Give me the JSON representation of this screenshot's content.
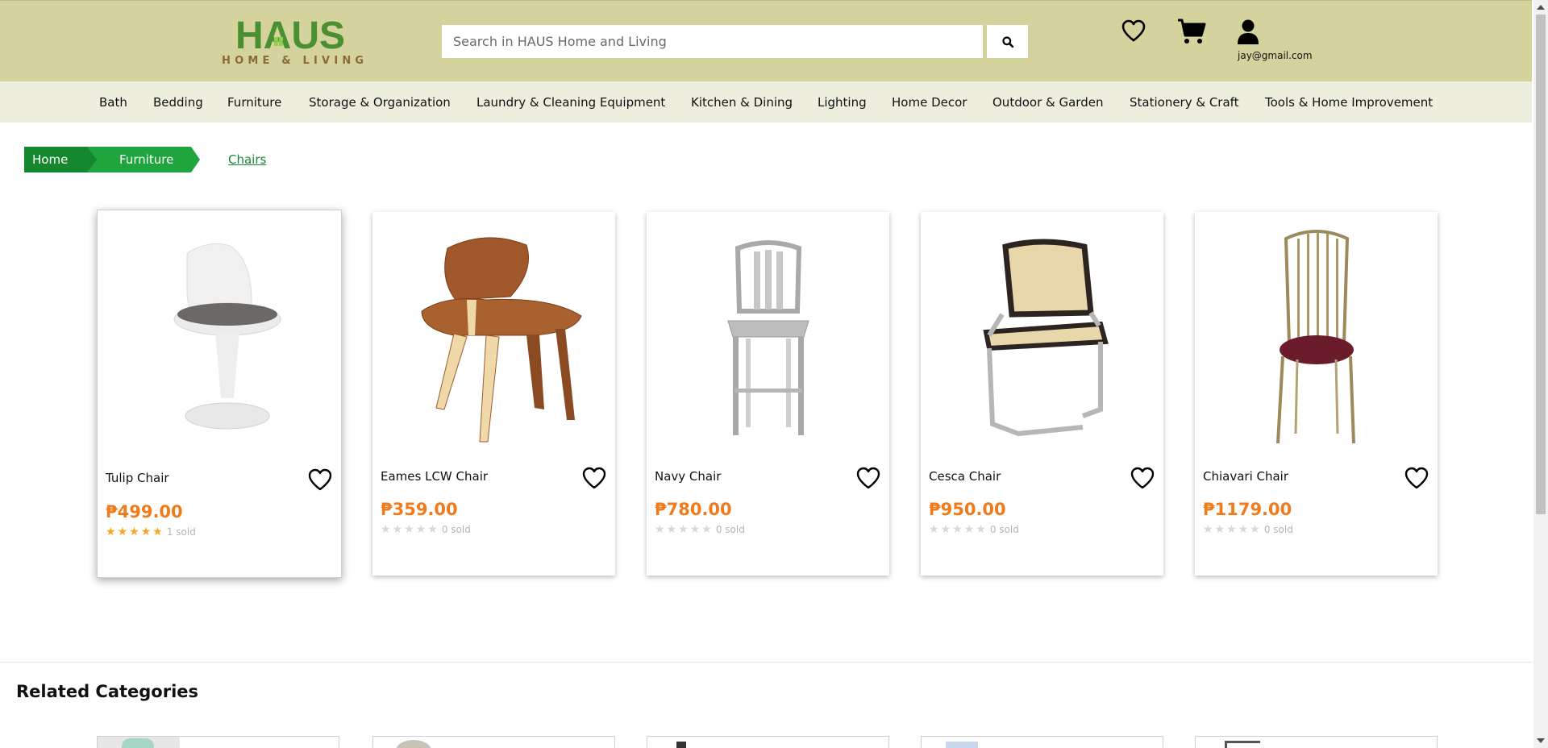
{
  "header": {
    "logo_word": "HAUS",
    "logo_sub": "HOME & LIVING",
    "search_placeholder": "Search in HAUS Home and Living",
    "search_icon": "search-icon",
    "wishlist_icon": "heart-icon",
    "cart_icon": "cart-icon",
    "user_icon": "user-icon",
    "user_email": "jay@gmail.com"
  },
  "nav": {
    "items": [
      "Bath",
      "Bedding",
      "Furniture",
      "Storage & Organization",
      "Laundry & Cleaning Equipment",
      "Kitchen & Dining",
      "Lighting",
      "Home Decor",
      "Outdoor & Garden",
      "Stationery & Craft",
      "Tools & Home Improvement"
    ]
  },
  "breadcrumb": {
    "home": "Home",
    "category": "Furniture",
    "current": "Chairs"
  },
  "products": [
    {
      "name": "Tulip Chair",
      "price": "₱499.00",
      "rating": 5,
      "sold": "1 sold"
    },
    {
      "name": "Eames LCW Chair",
      "price": "₱359.00",
      "rating": 0,
      "sold": "0 sold"
    },
    {
      "name": "Navy Chair",
      "price": "₱780.00",
      "rating": 0,
      "sold": "0 sold"
    },
    {
      "name": "Cesca Chair",
      "price": "₱950.00",
      "rating": 0,
      "sold": "0 sold"
    },
    {
      "name": "Chiavari Chair",
      "price": "₱1179.00",
      "rating": 0,
      "sold": "0 sold"
    }
  ],
  "related": {
    "title": "Related Categories"
  },
  "colors": {
    "header_bg": "#d4d29d",
    "nav_bg": "#eeeede",
    "brand_green": "#4a8f32",
    "breadcrumb_dark": "#15882f",
    "breadcrumb_light": "#1ea53d",
    "price_orange": "#f07b1d",
    "star_gold": "#f5a623"
  }
}
